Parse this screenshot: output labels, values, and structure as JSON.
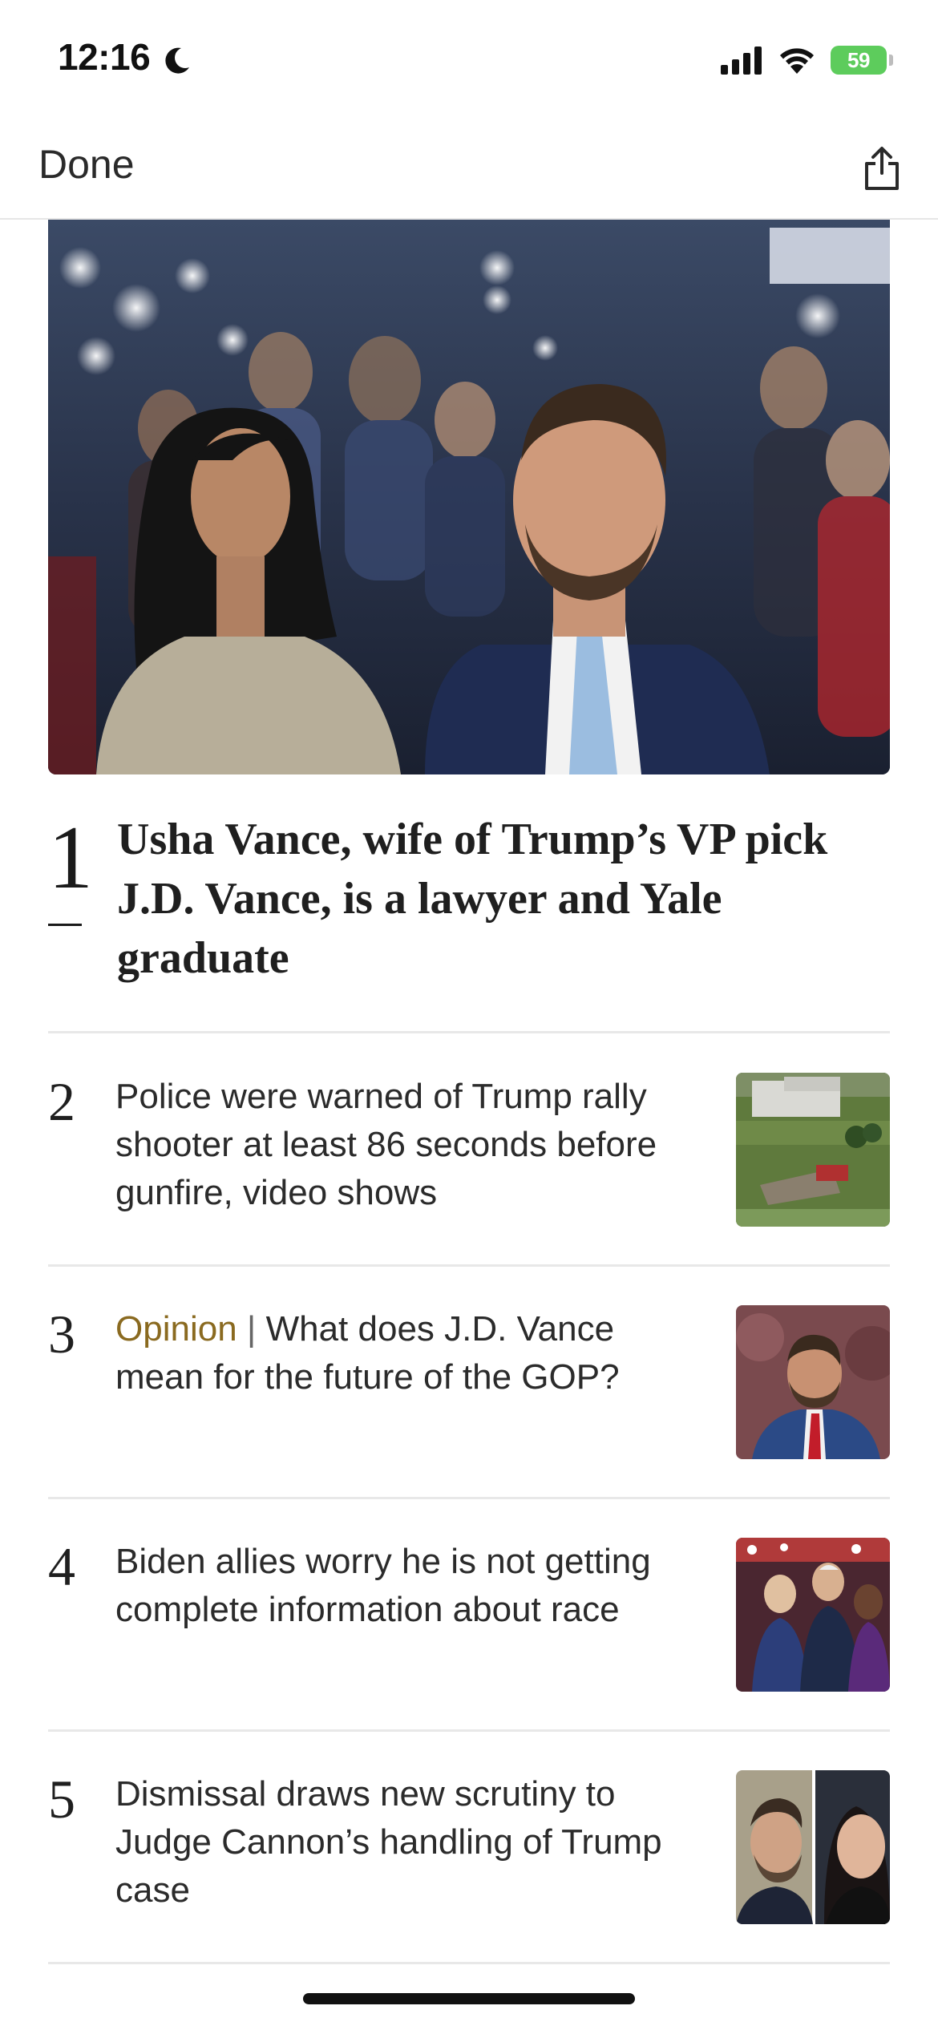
{
  "status_bar": {
    "time": "12:16",
    "battery_percent": "59",
    "battery_color": "#5dcc5c",
    "focus_icon": "moon-icon",
    "signal_icon": "cellular-signal-icon",
    "wifi_icon": "wifi-icon"
  },
  "nav": {
    "done_label": "Done",
    "share_icon": "share-icon"
  },
  "top_story": {
    "rank": "1",
    "headline": "Usha Vance, wife of Trump’s VP pick J.D. Vance, is a lawyer and Yale graduate"
  },
  "stories": [
    {
      "rank": "2",
      "headline": "Police were warned of Trump rally shooter at least 86 seconds before gunfire, video shows"
    },
    {
      "rank": "3",
      "kicker": "Opinion",
      "separator": "|",
      "headline": "What does J.D. Vance mean for the future of the GOP?"
    },
    {
      "rank": "4",
      "headline": "Biden allies worry he is not getting complete information about race"
    },
    {
      "rank": "5",
      "headline": "Dismissal draws new scrutiny to Judge Cannon’s handling of Trump case"
    }
  ],
  "colors": {
    "opinion_kicker": "#8a6a20",
    "divider": "#e8e8e8"
  }
}
